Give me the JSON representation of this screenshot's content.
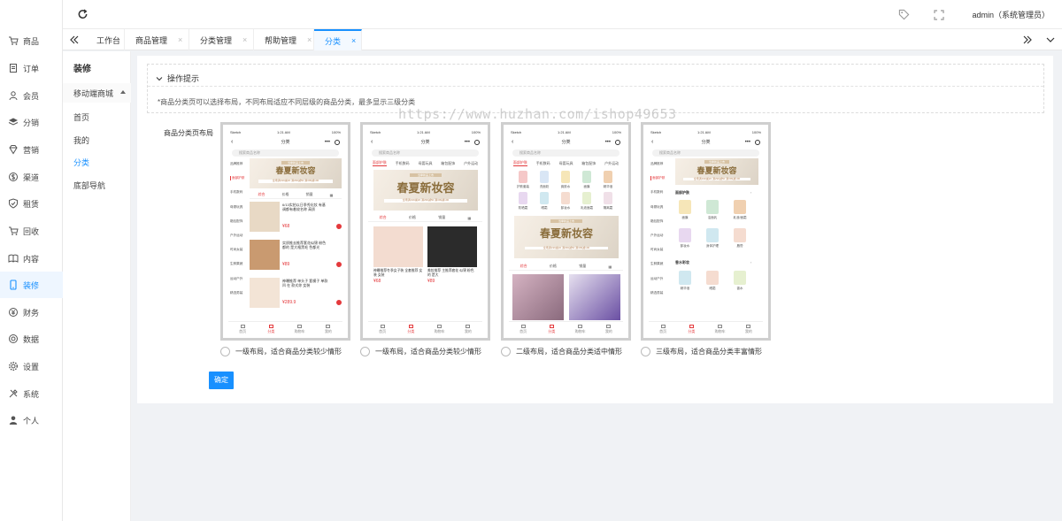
{
  "rail": [
    {
      "label": "商品",
      "icon": "cart-icon"
    },
    {
      "label": "订单",
      "icon": "order-icon"
    },
    {
      "label": "会员",
      "icon": "user-icon"
    },
    {
      "label": "分销",
      "icon": "layers-icon"
    },
    {
      "label": "营销",
      "icon": "diamond-icon"
    },
    {
      "label": "渠道",
      "icon": "dollar-circle-icon"
    },
    {
      "label": "租赁",
      "icon": "shield-check-icon"
    },
    {
      "label": "回收",
      "icon": "cart-icon"
    },
    {
      "label": "内容",
      "icon": "book-icon"
    },
    {
      "label": "装修",
      "icon": "mobile-icon"
    },
    {
      "label": "财务",
      "icon": "money-icon"
    },
    {
      "label": "数据",
      "icon": "chart-icon"
    },
    {
      "label": "设置",
      "icon": "gear-icon"
    },
    {
      "label": "系统",
      "icon": "tools-icon"
    },
    {
      "label": "个人",
      "icon": "person-icon"
    }
  ],
  "rail_active_index": 9,
  "topbar": {
    "user": "admin（系统管理员）"
  },
  "tabs": [
    {
      "label": "工作台",
      "closable": false
    },
    {
      "label": "商品管理",
      "closable": true
    },
    {
      "label": "分类管理",
      "closable": true
    },
    {
      "label": "帮助管理",
      "closable": true
    },
    {
      "label": "分类",
      "closable": true,
      "active": true
    }
  ],
  "tab_close_glyph": "×",
  "subnav": {
    "title": "装修",
    "group": "移动端商城",
    "items": [
      "首页",
      "我的",
      "分类",
      "底部导航"
    ],
    "active": "分类"
  },
  "tips": {
    "title": "操作提示",
    "body": "*商品分类页可以选择布局，不同布局适应不同层级的商品分类，最多显示三级分类"
  },
  "watermark": "https://www.huzhan.com/ishop49653",
  "form": {
    "label": "商品分类页布局",
    "submit_label": "确定"
  },
  "layouts": [
    {
      "label": "一级布局，适合商品分类较少情形"
    },
    {
      "label": "一级布局，适合商品分类较少情形"
    },
    {
      "label": "二级布局，适合商品分类适中情形"
    },
    {
      "label": "三级布局，适合商品分类丰富情形"
    }
  ],
  "phone": {
    "carrier": "Sketch",
    "time": "1:21 AM",
    "battery": "100%",
    "page_title": "分类",
    "search_placeholder": "搜索商品名称",
    "back_glyph": "‹",
    "menu_glyph": "•••",
    "tabbar": [
      "首页",
      "分类",
      "购物车",
      "我的"
    ],
    "categories": [
      "品牌推荐",
      "面部护肤",
      "手机数码",
      "母婴玩具",
      "箱包配饰",
      "户外运动",
      "时尚女装",
      "生鲜果蔬",
      "运动户外",
      "精选男装"
    ],
    "top_categories": [
      "面部护肤",
      "手机数码",
      "母婴玩具",
      "箱包配饰",
      "户外运动"
    ],
    "banner_tag": "当季新品上市",
    "banner_title": "春夏新妆容",
    "banner_sub": "全场满199减20 满299减50 满399减100",
    "sort": [
      "综合",
      "价格",
      "销量",
      "▦"
    ],
    "products": [
      {
        "title": "6/13实拍以日季秀化妆 有基调都有着较名称 高质",
        "price": "¥68"
      },
      {
        "title": "实质推去推荐套花似锦 粉色都的 是大格黑毛 色都光",
        "price": "¥89"
      },
      {
        "title": "神曝推荐 单头子 套模子 单款凹 在 款式你 女装",
        "price": "¥289.9"
      }
    ],
    "grid_products": [
      {
        "title": "神曝推荐冬季女子装 全套推荐 女装 女装",
        "price": "¥68"
      },
      {
        "title": "美妆推荐 主推荐套花 似锦 粉色的 是大",
        "price": "¥89"
      }
    ],
    "sub_icons": [
      "护肤套装",
      "洗面奶",
      "爽肤水",
      "面膜",
      "精华液",
      "防晒霜",
      "眼霜",
      "卸妆水",
      "乳液面霜",
      "隔离霜"
    ],
    "section_titles": [
      "面部护肤",
      "香水彩妆"
    ],
    "section_more": "›",
    "three_icons": [
      "面膜",
      "洁面乳",
      "乳液/面霜",
      "卸妆水",
      "身体护理",
      "唇膏",
      "精华液",
      "眼霜",
      "香水"
    ]
  }
}
